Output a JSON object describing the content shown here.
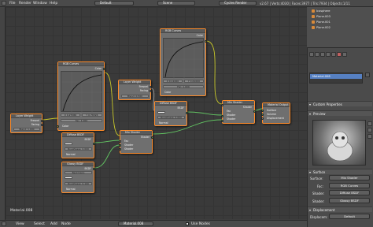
{
  "topbar": {
    "menus": [
      "File",
      "Render",
      "Window",
      "Help"
    ],
    "layout": "Default",
    "scene": "Scene",
    "engine": "Cycles Render",
    "stats": "v2.67 | Verts:4030 | Faces:3977 | Tris:7934 | Objects:1/11"
  },
  "nodes": {
    "rgb_curves_1": {
      "title": "RGB Curves",
      "fac_label": "Fac: 1.000",
      "x_val": "X 0.27066",
      "y_val": "Y 0.76324",
      "fac_in": "Fac",
      "color_in": "Color",
      "out": "Color"
    },
    "rgb_curves_2": {
      "title": "RGB Curves",
      "fac_label": "Fac: 1.000",
      "x_val": "X 0.11000",
      "y_val": "Y 0.61000",
      "fac_in": "Fac",
      "color_in": "Color",
      "out": "Color"
    },
    "layer_weight_1": {
      "title": "Layer Weight",
      "blend": "Blend: 1.000",
      "out1": "Fresnel",
      "out2": "Facing",
      "normal": "Normal"
    },
    "layer_weight_2": {
      "title": "Layer Weight",
      "blend": "Blend: 0.500",
      "out1": "Fresnel",
      "out2": "Facing"
    },
    "diffuse_1": {
      "title": "Diffuse BSDF",
      "out": "BSDF",
      "color": "Color",
      "roughness": "Roughness: 0.000",
      "normal": "Normal"
    },
    "diffuse_2": {
      "title": "Diffuse BSDF",
      "out": "BSDF",
      "color": "Color",
      "roughness": "Roughness: 0.000",
      "normal": "Normal"
    },
    "glossy": {
      "title": "Glossy BSDF",
      "out": "BSDF",
      "dist": "Beckmann",
      "color": "Color",
      "roughness": "Roughness: 0.100",
      "normal": "Normal"
    },
    "mix_1": {
      "title": "Mix Shader",
      "out": "Shader",
      "fac": "Fac",
      "s1": "Shader",
      "s2": "Shader"
    },
    "mix_2": {
      "title": "Mix Shader",
      "out": "Shader",
      "fac": "Fac",
      "s1": "Shader",
      "s2": "Shader"
    },
    "output": {
      "title": "Material Output",
      "surface": "Surface",
      "volume": "Volume",
      "displacement": "Displacement"
    }
  },
  "material_label": "Material.008",
  "bottombar": {
    "menus": [
      "View",
      "Select",
      "Add",
      "Node"
    ],
    "material": "Material.008",
    "use_nodes": "Use Nodes"
  },
  "outliner": {
    "items": [
      "Icosphere",
      "Plane.003",
      "Plane.001",
      "Plane.002"
    ]
  },
  "properties": {
    "material_slot": "Material.008",
    "custom_properties": "Custom Properties",
    "preview": "Preview",
    "surface_section": "Surface",
    "surface_label": "Surface:",
    "surface_value": "Mix Shader",
    "fac_label": "Fac:",
    "fac_value": "RGB Curves",
    "shader1_label": "Shader:",
    "shader1_value": "Diffuse BSDF",
    "shader2_label": "Shader:",
    "shader2_value": "Glossy BSDF",
    "displacement_section": "Displacement",
    "displacement_label": "Displacem:",
    "displacement_value": "Default"
  },
  "colors": {
    "node_border": "#ff8c2a",
    "socket_color": "#c7c729",
    "socket_shader": "#63c763",
    "socket_value": "#a1a1a1",
    "socket_vector": "#6363c7",
    "selection": "#5680c2"
  }
}
